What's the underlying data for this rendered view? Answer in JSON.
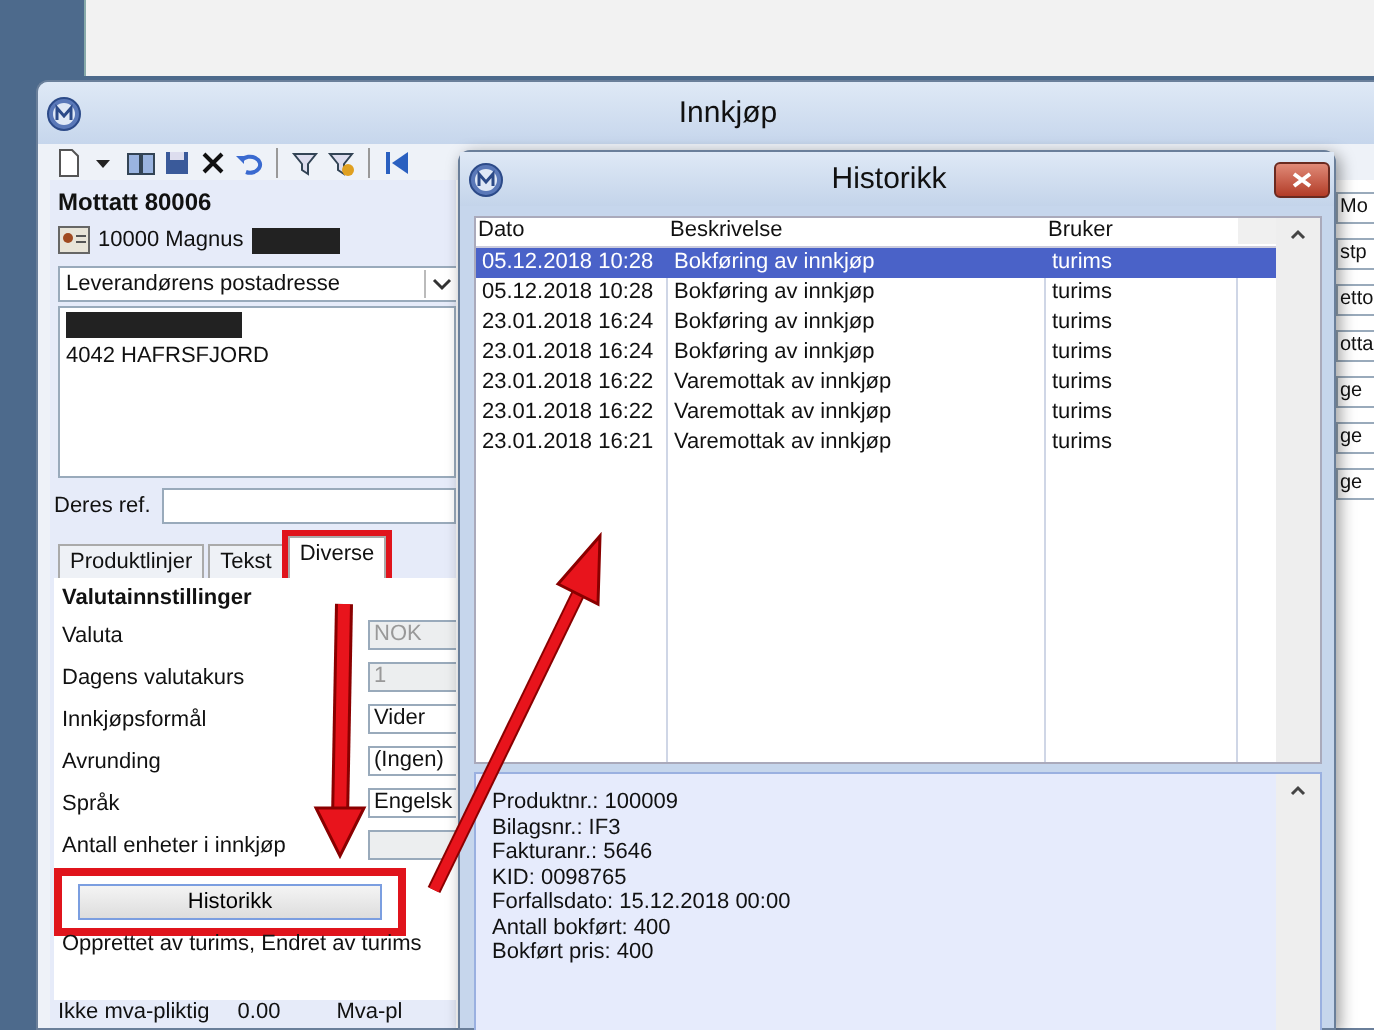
{
  "main_window": {
    "title": "Innkjøp",
    "heading": "Mottatt 80006",
    "supplier": "10000 Magnus",
    "address_dropdown": "Leverandørens postadresse",
    "address_lines": [
      "4042 HAFRSFJORD"
    ],
    "reference_label": "Deres ref.",
    "tabs": [
      {
        "label": "Produktlinjer",
        "selected": false,
        "highlighted": false
      },
      {
        "label": "Tekst",
        "selected": false,
        "highlighted": false
      },
      {
        "label": "Diverse",
        "selected": true,
        "highlighted": true
      }
    ],
    "section_title": "Valutainnstillinger",
    "settings": [
      {
        "label": "Valuta",
        "value": "NOK",
        "disabled": true
      },
      {
        "label": "Dagens valutakurs",
        "value": "1",
        "disabled": true
      },
      {
        "label": "Innkjøpsformål",
        "value": "Vider",
        "disabled": false
      },
      {
        "label": "Avrunding",
        "value": "(Ingen)",
        "disabled": false
      },
      {
        "label": "Språk",
        "value": "Engelsk",
        "disabled": false
      },
      {
        "label": "Antall enheter i innkjøp",
        "disabled": true
      }
    ],
    "history_button": {
      "label": "Historikk",
      "highlighted": true
    },
    "audit_text": "Opprettet av turims, Endret av turims",
    "footer": {
      "label": "Ikke mva-pliktig",
      "value": "0.00",
      "label_2": "Mva-pl"
    },
    "right_fields": [
      "Mo",
      "stp",
      "etto",
      "otta",
      "ge",
      "ge",
      "ge"
    ]
  },
  "history_dialog": {
    "title": "Historikk",
    "columns": [
      "Dato",
      "Beskrivelse",
      "Bruker"
    ],
    "rows": [
      {
        "cells": [
          "05.12.2018 10:28",
          "Bokføring av innkjøp",
          "turims"
        ],
        "selected": true
      },
      {
        "cells": [
          "05.12.2018 10:28",
          "Bokføring av innkjøp",
          "turims"
        ],
        "selected": false
      },
      {
        "cells": [
          "23.01.2018 16:24",
          "Bokføring av innkjøp",
          "turims"
        ],
        "selected": false
      },
      {
        "cells": [
          "23.01.2018 16:24",
          "Bokføring av innkjøp",
          "turims"
        ],
        "selected": false
      },
      {
        "cells": [
          "23.01.2018 16:22",
          "Varemottak av innkjøp",
          "turims"
        ],
        "selected": false
      },
      {
        "cells": [
          "23.01.2018 16:22",
          "Varemottak av innkjøp",
          "turims"
        ],
        "selected": false
      },
      {
        "cells": [
          "23.01.2018 16:21",
          "Varemottak av innkjøp",
          "turims"
        ],
        "selected": false
      }
    ],
    "details": [
      "Produktnr.: 100009",
      "Bilagsnr.: IF3",
      "Fakturanr.: 5646",
      "KID: 0098765",
      "Forfallsdato: 15.12.2018 00:00",
      "Antall bokført: 400",
      "Bokført pris: 400"
    ]
  }
}
